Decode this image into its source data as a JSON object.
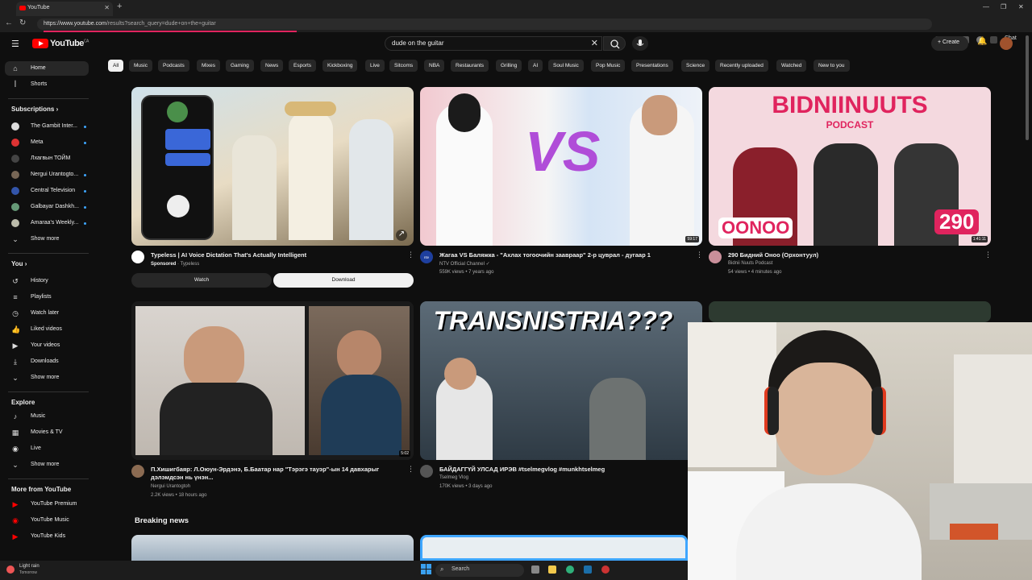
{
  "browser": {
    "tab_title": "YouTube",
    "url_host": "https://www.youtube.com",
    "url_path": "/results?search_query=dude+on+the+guitar",
    "profile_label": "Chat"
  },
  "header": {
    "logo_text": "YouTube",
    "country": "CA",
    "search_value": "dude on the guitar",
    "create_label": "Create"
  },
  "sidebar": {
    "main": [
      {
        "label": "Home",
        "icon": "home-icon"
      },
      {
        "label": "Shorts",
        "icon": "shorts-icon"
      }
    ],
    "subscriptions_title": "Subscriptions",
    "subscriptions": [
      {
        "label": "The Gambit Inter..."
      },
      {
        "label": "Meta"
      },
      {
        "label": "Лхагвын ТОЙМ"
      },
      {
        "label": "Nergui Urantogto..."
      },
      {
        "label": "Central Television"
      },
      {
        "label": "Galbayar Dashkh..."
      },
      {
        "label": "Amaraa's Weekly..."
      }
    ],
    "show_more": "Show more",
    "you_title": "You",
    "you_items": [
      {
        "label": "History",
        "icon": "history-icon"
      },
      {
        "label": "Playlists",
        "icon": "playlists-icon"
      },
      {
        "label": "Watch later",
        "icon": "watch-later-icon"
      },
      {
        "label": "Liked videos",
        "icon": "like-icon"
      },
      {
        "label": "Your videos",
        "icon": "your-videos-icon"
      },
      {
        "label": "Downloads",
        "icon": "download-icon"
      },
      {
        "label": "Show more",
        "icon": "chevron-down-icon"
      }
    ],
    "explore_title": "Explore",
    "explore_items": [
      {
        "label": "Music",
        "icon": "music-icon"
      },
      {
        "label": "Movies & TV",
        "icon": "movies-icon"
      },
      {
        "label": "Live",
        "icon": "live-icon"
      },
      {
        "label": "Show more",
        "icon": "chevron-down-icon"
      }
    ],
    "more_title": "More from YouTube",
    "more_items": [
      {
        "label": "YouTube Premium"
      },
      {
        "label": "YouTube Music"
      },
      {
        "label": "YouTube Kids"
      }
    ]
  },
  "chips": [
    "All",
    "Music",
    "Podcasts",
    "Mixes",
    "Gaming",
    "News",
    "Esports",
    "Kickboxing",
    "Live",
    "Sitcoms",
    "NBA",
    "Restaurants",
    "Grilling",
    "AI",
    "Soul Music",
    "Pop Music",
    "Presentations",
    "Science",
    "Recently uploaded",
    "Watched",
    "New to you"
  ],
  "videos": [
    {
      "title": "Typeless | AI Voice Dictation That's Actually Intelligent",
      "channel": "Typeless",
      "sponsored": "Sponsored",
      "watch": "Watch",
      "download": "Download"
    },
    {
      "title": "Жагаа VS Баляжка - \"Ахлах тогоочийн заавраар\" 2-р цуврал - дугаар 1",
      "channel": "NTV Official Channel",
      "meta": "559K views • 7 years ago",
      "duration": "59:17",
      "ch_badge": "ntv"
    },
    {
      "title": "290 Бидний Оноо (Орхонтуул)",
      "channel": "Bidnii Nuuts Podcast",
      "meta": "54 views • 4 minutes ago",
      "duration": "1:41:11",
      "thumb_title": "BIDNIINUUTS",
      "thumb_sub": "PODCAST",
      "thumb_oonoo": "OONOO",
      "thumb_num": "290"
    },
    {
      "title": "П.Хишигбаяр: Л.Оюун-Эрдэнэ, Б.Баатар нар \"Тэрэгэ тауэр\"-ын 14 давхарыг дэлэмдсэн нь үнэн...",
      "channel": "Nergui Urantogtoh",
      "meta": "2.2K views • 18 hours ago",
      "duration": "5:02"
    },
    {
      "title": "БАЙДАГГҮЙ УЛСАД ИРЭВ #tselmegvlog #munkhtselmeg",
      "channel": "Tselmeg Vlog",
      "meta": "170K views • 3 days ago",
      "thumb_title": "TRANSNISTRIA???"
    }
  ],
  "section": {
    "breaking_news": "Breaking news"
  },
  "taskbar": {
    "weather_title": "Light rain",
    "weather_sub": "Tomorrow",
    "search_label": "Search"
  },
  "colors": {
    "accent_red": "#ff0000",
    "bg": "#0f0f0f",
    "chip_bg": "#272727",
    "verified_blue": "#3ea6ff"
  }
}
